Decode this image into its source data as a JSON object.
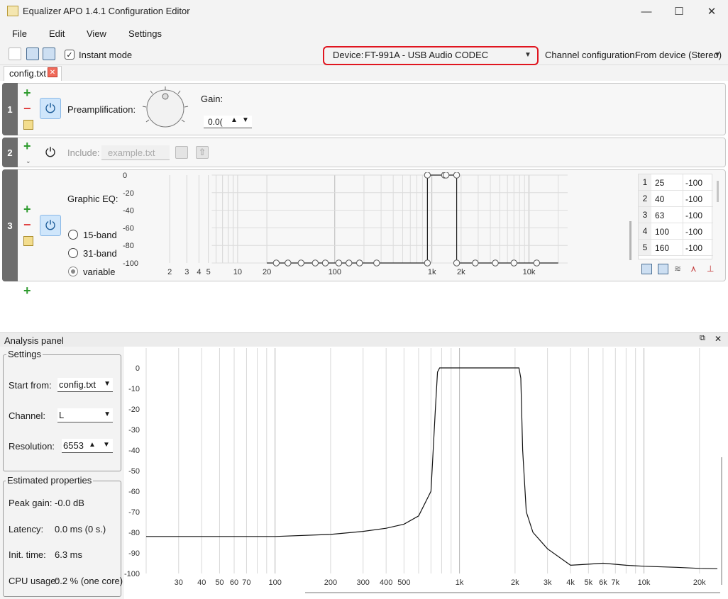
{
  "window": {
    "title": "Equalizer APO 1.4.1 Configuration Editor",
    "minimize": "—",
    "maximize": "☐",
    "close": "✕"
  },
  "menu": [
    "File",
    "Edit",
    "View",
    "Settings"
  ],
  "toolbar": {
    "instant_mode": "Instant mode",
    "instant_checked": "✓",
    "device_label": "Device:",
    "device_value": "FT-991A - USB Audio CODEC",
    "channel_label": "Channel configuration:",
    "channel_value": "From device (Stereo)"
  },
  "tabs": [
    {
      "label": "config.txt",
      "close": "✕"
    }
  ],
  "rows": [
    {
      "num": "1",
      "label": "Preamplification:",
      "gain_label": "Gain:",
      "gain_value": "0.0("
    },
    {
      "num": "2",
      "label": "Include:",
      "placeholder": "example.txt"
    },
    {
      "num": "3",
      "label": "Graphic EQ:",
      "options": [
        "15-band",
        "31-band",
        "variable"
      ]
    }
  ],
  "eq_graph": {
    "y_ticks": [
      "0",
      "-20",
      "-40",
      "-60",
      "-80",
      "-100"
    ],
    "x_ticks": [
      "2",
      "3",
      "4",
      "5",
      "10",
      "20",
      "100",
      "1k",
      "2k",
      "10k"
    ],
    "bands": [
      {
        "idx": "1",
        "freq": "25",
        "gain": "-100"
      },
      {
        "idx": "2",
        "freq": "40",
        "gain": "-100"
      },
      {
        "idx": "3",
        "freq": "63",
        "gain": "-100"
      },
      {
        "idx": "4",
        "freq": "100",
        "gain": "-100"
      },
      {
        "idx": "5",
        "freq": "160",
        "gain": "-100"
      }
    ]
  },
  "analysis": {
    "title": "Analysis panel",
    "settings_title": "Settings",
    "start_from_label": "Start from:",
    "start_from_value": "config.txt",
    "channel_label": "Channel:",
    "channel_value": "L",
    "resolution_label": "Resolution:",
    "resolution_value": "6553",
    "estimated_title": "Estimated properties",
    "peak_gain_label": "Peak gain:",
    "peak_gain_value": "-0.0 dB",
    "latency_label": "Latency:",
    "latency_value": "0.0 ms (0 s.)",
    "init_label": "Init. time:",
    "init_value": "6.3 ms",
    "cpu_label": "CPU usage:",
    "cpu_value": "0.2 % (one core)"
  },
  "chart_data": {
    "type": "line",
    "x_scale": "log",
    "xlim": [
      20,
      25000
    ],
    "ylim": [
      -100,
      0
    ],
    "y_ticks": [
      "0",
      "-10",
      "-20",
      "-30",
      "-40",
      "-50",
      "-60",
      "-70",
      "-80",
      "-90",
      "-100"
    ],
    "x_ticks": [
      "30",
      "40",
      "50",
      "60",
      "70",
      "100",
      "200",
      "300",
      "400",
      "500",
      "1k",
      "2k",
      "3k",
      "4k",
      "5k",
      "6k",
      "7k",
      "10k",
      "20k"
    ],
    "grid": true,
    "series": [
      {
        "x": [
          20,
          50,
          100,
          200,
          300,
          400,
          500,
          600,
          700,
          740,
          760,
          780,
          1500,
          2100,
          2150,
          2200,
          2300,
          2500,
          3000,
          4000,
          5000,
          6000,
          8000,
          10000,
          15000,
          20000,
          25000
        ],
        "y": [
          -82,
          -82,
          -82,
          -81,
          -79.5,
          -78,
          -76,
          -72,
          -60,
          -20,
          -2,
          0,
          0,
          0,
          -5,
          -40,
          -70,
          -80,
          -88,
          -96,
          -95.5,
          -95,
          -96,
          -96.5,
          -97,
          -97.5,
          -97.7
        ]
      }
    ]
  }
}
